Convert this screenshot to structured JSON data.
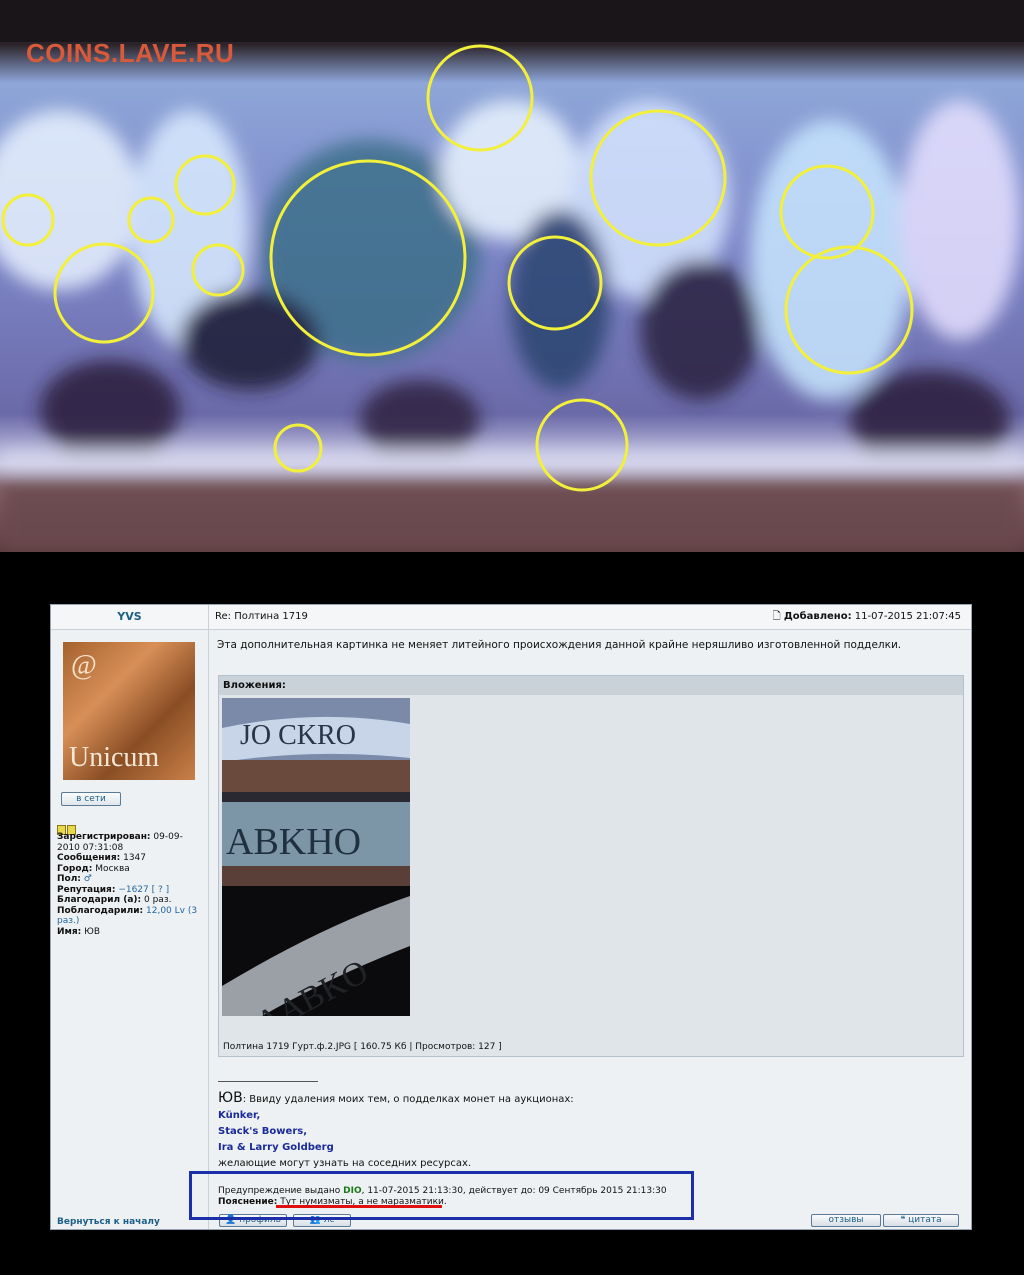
{
  "watermark": "COINS.LAVE.RU",
  "colors": {
    "highlight_circle": "#f2f03a",
    "warning_box": "#1d2fa8",
    "underline": "#e01010",
    "link_blue": "#1b5f86"
  },
  "post": {
    "author": "YVS",
    "subject": "Re: Полтина 1719",
    "added_label": "Добавлено:",
    "added_date": "11-07-2015 21:07:45",
    "avatar": {
      "at": "@",
      "text": "Unicum"
    },
    "online_button": "в сети",
    "profile": [
      {
        "label": "Зарегистрирован:",
        "value": "09-09-2010 07:31:08"
      },
      {
        "label": "Сообщения:",
        "value": "1347"
      },
      {
        "label": "Город:",
        "value": "Москва"
      },
      {
        "label": "Пол:",
        "value": "♂"
      },
      {
        "label": "Репутация:",
        "value": "−1627 [ ? ]"
      },
      {
        "label": "Благодарил (а):",
        "value": "0 раз."
      },
      {
        "label": "Поблагодарили:",
        "value": "12,00 Lv (3 раз.)"
      },
      {
        "label": "Имя:",
        "value": "ЮВ"
      }
    ],
    "message": "Эта дополнительная картинка не меняет литейного происхождения данной крайне неряшливо изготовленной подделки.",
    "attachments_title": "Вложения:",
    "attachment_caption": "Полтина 1719 Гурт.ф.2.JPG [ 160.75 Кб | Просмотров: 127 ]",
    "signature": {
      "name": "ЮВ",
      "text": ": Ввиду удаления моих тем, о подделках монет на аукционах:",
      "links": [
        "Künker,",
        "Stack's Bowers,",
        "Ira & Larry Goldberg"
      ],
      "tail": "желающие могут узнать на соседних ресурсах."
    },
    "warning": {
      "prefix": "Предупреждение выдано",
      "moderator": "DIO",
      "rest": ", 11-07-2015 21:13:30, действует до: 09 Сентябрь 2015 21:13:30",
      "note_label": "Пояснение:",
      "note": "Тут нумизматы, а не маразматики."
    },
    "back_to_top": "Вернуться к началу",
    "buttons": {
      "profile": "профиль",
      "pm": "лс",
      "reviews": "отзывы",
      "quote": "цитата"
    }
  }
}
